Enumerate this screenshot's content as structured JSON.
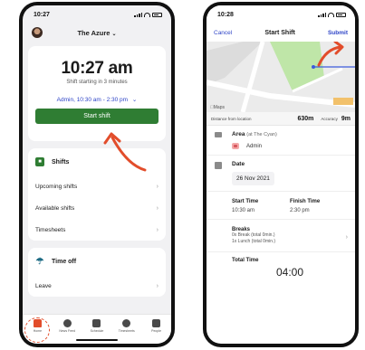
{
  "left": {
    "status_time": "10:27",
    "location": "The Azure",
    "clock_time": "10:27 am",
    "shift_starting": "Shift starting in 3 minutes",
    "shift_select": "Admin, 10:30 am - 2:30 pm",
    "start_button": "Start shift",
    "shifts_section": {
      "title": "Shifts",
      "items": [
        {
          "label": "Upcoming shifts"
        },
        {
          "label": "Available shifts"
        },
        {
          "label": "Timesheets"
        }
      ]
    },
    "timeoff_section": {
      "title": "Time off",
      "items": [
        {
          "label": "Leave"
        }
      ]
    },
    "tabs": [
      {
        "label": "Home"
      },
      {
        "label": "News Feed"
      },
      {
        "label": "Schedule"
      },
      {
        "label": "Timesheets"
      },
      {
        "label": "People"
      }
    ]
  },
  "right": {
    "status_time": "10:28",
    "nav": {
      "cancel": "Cancel",
      "title": "Start Shift",
      "submit": "Submit"
    },
    "map_label": "Maps",
    "distance_label": "Distance from location",
    "distance_value": "630m",
    "accuracy_label": "Accuracy",
    "accuracy_value": "9m",
    "area_label": "Area",
    "area_sub": "(at The Cyan)",
    "area_value": "Admin",
    "date_label": "Date",
    "date_value": "26 Nov 2021",
    "start_time_label": "Start Time",
    "start_time_value": "10:30 am",
    "finish_time_label": "Finish Time",
    "finish_time_value": "2:30 pm",
    "breaks_label": "Breaks",
    "breaks_line1": "0x Break (total 0min.)",
    "breaks_line2": "1x Lunch (total 0min.)",
    "total_time_label": "Total Time",
    "total_time_value": "04:00"
  },
  "colors": {
    "primary_green": "#2f7d33",
    "link_blue": "#2e44c7",
    "annotation_red": "#e24d2b"
  }
}
